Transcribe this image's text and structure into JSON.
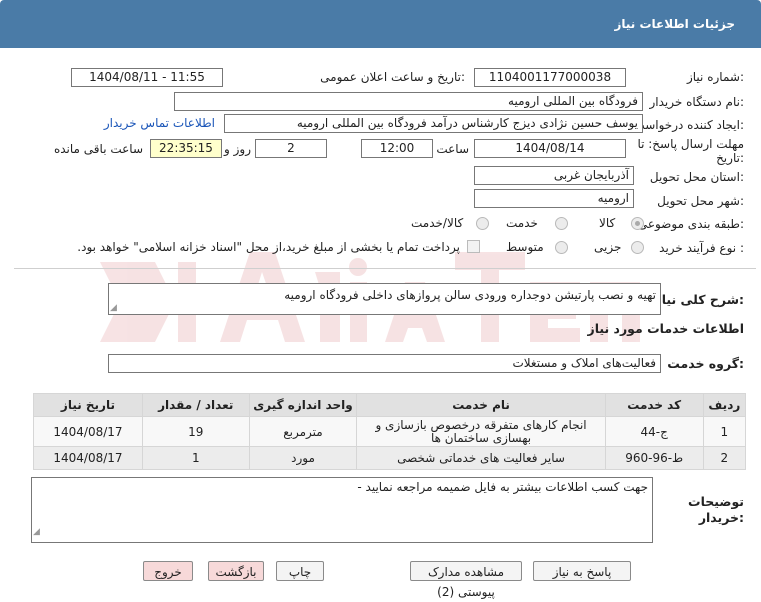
{
  "header": {
    "title": "جزئیات اطلاعات نیاز"
  },
  "fields": {
    "need_number_label": "شماره نیاز:",
    "need_number": "1104001177000038",
    "announce_label": "تاریخ و ساعت اعلان عمومی:",
    "announce_value": "1404/08/11 - 11:55",
    "buyer_org_label": "نام دستگاه خریدار:",
    "buyer_org": "فرودگاه بین المللی ارومیه",
    "creator_label": "ایجاد کننده درخواست:",
    "creator": "یوسف حسین نژادی دیزج کارشناس درآمد فرودگاه بین المللی ارومیه",
    "contact_link": "اطلاعات تماس خریدار",
    "deadline_label_1": "مهلت ارسال پاسخ: تا",
    "deadline_label_2": "تاریخ:",
    "deadline_date": "1404/08/14",
    "time_label": "ساعت",
    "deadline_time": "12:00",
    "days": "2",
    "days_label": "روز و",
    "remaining": "22:35:15",
    "remaining_label": "ساعت باقی مانده",
    "province_label": "استان محل تحویل:",
    "province": "آذربایجان غربی",
    "city_label": "شهر محل تحویل:",
    "city": "ارومیه",
    "category_label": "طبقه بندی موضوعی:",
    "category_options": [
      "کالا",
      "خدمت",
      "کالا/خدمت"
    ],
    "process_label": "نوع فرآیند خرید :",
    "process_options": [
      "جزیی",
      "متوسط"
    ],
    "payment_note": "پرداخت تمام یا بخشی از مبلغ خرید،از محل \"اسناد خزانه اسلامی\" خواهد بود."
  },
  "summary": {
    "label": "شرح کلی نیاز:",
    "value": "تهیه و نصب پارتیشن دوجداره ورودی سالن پروازهای داخلی فرودگاه ارومیه"
  },
  "services": {
    "section_title": "اطلاعات خدمات مورد نیاز",
    "group_label": "گروه خدمت:",
    "group_value": "فعالیت‌های  املاک و مستغلات",
    "table": {
      "headers": [
        "ردیف",
        "کد خدمت",
        "نام خدمت",
        "واحد اندازه گیری",
        "تعداد / مقدار",
        "تاریخ نیاز"
      ],
      "rows": [
        [
          "1",
          "ج-44",
          "انجام کارهای متفرقه درخصوص بازسازی و بهسازی ساختمان ها",
          "مترمربع",
          "19",
          "1404/08/17"
        ],
        [
          "2",
          "ط-96-960",
          "سایر فعالیت های خدماتی شخصی",
          "مورد",
          "1",
          "1404/08/17"
        ]
      ]
    }
  },
  "buyer_notes": {
    "label_1": "توضیحات",
    "label_2": "خریدار:",
    "value": "جهت کسب اطلاعات بیشتر به فایل ضمیمه مراجعه نمایید -"
  },
  "buttons": {
    "reply": "پاسخ به نیاز",
    "view_docs": "مشاهده مدارک پیوستی (2)",
    "print": "چاپ",
    "back": "بازگشت",
    "exit": "خروج"
  },
  "colors": {
    "header_bg": "#4a7ba7",
    "link": "#1a55b8",
    "pink_button": "#f7d9d9",
    "yellow_field": "#ffffcc"
  }
}
